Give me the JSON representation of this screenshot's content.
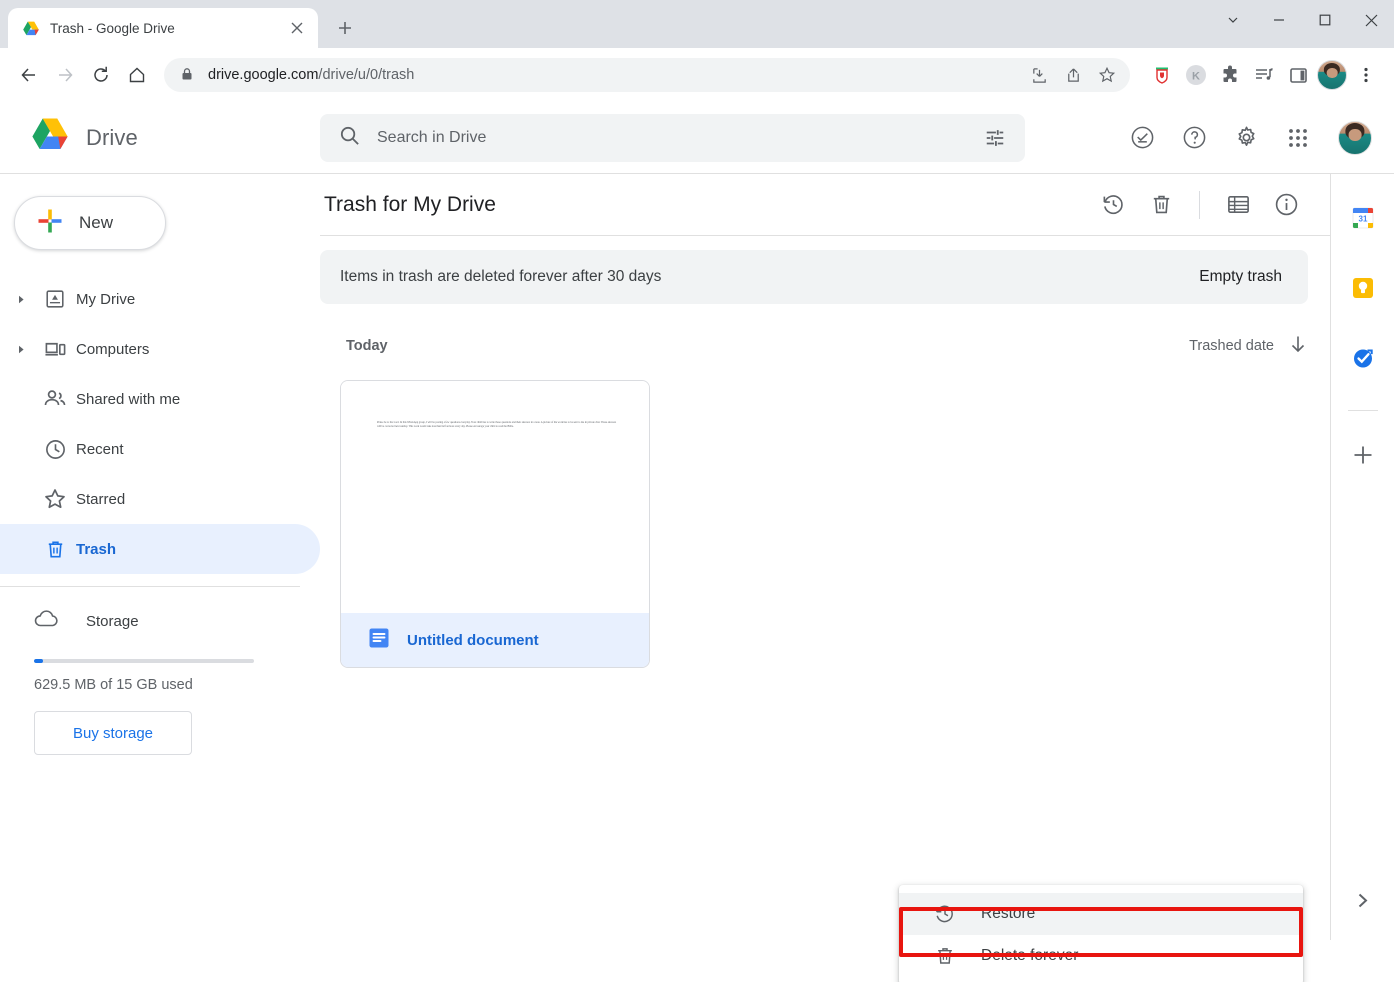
{
  "browser": {
    "tab": {
      "title": "Trash - Google Drive",
      "favicon": "google-drive-icon",
      "close": "×"
    },
    "new_tab_label": "+",
    "window_controls": {
      "tab_search": "⌄",
      "minimize": "–",
      "maximize": "□",
      "close": "×"
    },
    "nav": {
      "back": "←",
      "forward": "→",
      "reload": "⟳",
      "home": "⌂"
    },
    "omnibox": {
      "url_domain": "drive.google.com",
      "url_path": "/drive/u/0/trash",
      "lock": "lock-icon",
      "install": "install-icon",
      "share": "share-icon",
      "bookmark": "star-icon"
    },
    "extensions": [
      {
        "name": "honey-extension-icon",
        "label": ""
      },
      {
        "name": "k-extension-icon",
        "label": "K"
      },
      {
        "name": "puzzle-extensions-icon",
        "label": ""
      },
      {
        "name": "media-playlist-icon",
        "label": ""
      },
      {
        "name": "side-panel-icon",
        "label": ""
      }
    ],
    "profile": "profile-avatar",
    "menu": "three-dot-menu-icon"
  },
  "drive": {
    "brand": "Drive",
    "search": {
      "placeholder": "Search in Drive",
      "value": "",
      "tune": "tune-icon"
    },
    "header_actions": [
      {
        "name": "support-icon"
      },
      {
        "name": "help-icon"
      },
      {
        "name": "settings-gear-icon"
      },
      {
        "name": "apps-grid-icon"
      }
    ],
    "new_button": "New",
    "nav_items": [
      {
        "label": "My Drive",
        "icon": "my-drive-icon",
        "expandable": true,
        "active": false
      },
      {
        "label": "Computers",
        "icon": "computers-icon",
        "expandable": true,
        "active": false
      },
      {
        "label": "Shared with me",
        "icon": "shared-with-me-icon",
        "expandable": false,
        "active": false
      },
      {
        "label": "Recent",
        "icon": "recent-clock-icon",
        "expandable": false,
        "active": false
      },
      {
        "label": "Starred",
        "icon": "starred-star-icon",
        "expandable": false,
        "active": false
      },
      {
        "label": "Trash",
        "icon": "trash-icon",
        "expandable": false,
        "active": true
      }
    ],
    "storage": {
      "label": "Storage",
      "icon": "cloud-icon",
      "used_text": "629.5 MB of 15 GB used",
      "percent": 4,
      "buy_button": "Buy storage"
    },
    "main": {
      "title": "Trash for My Drive",
      "toolbar": [
        {
          "name": "restore-icon"
        },
        {
          "name": "delete-forever-icon"
        },
        {
          "name": "list-view-icon"
        },
        {
          "name": "details-info-icon"
        }
      ],
      "banner": {
        "text": "Items in trash are deleted forever after 30 days",
        "action": "Empty trash"
      },
      "group_label": "Today",
      "sort": {
        "label": "Trashed date",
        "direction": "down-arrow-icon"
      },
      "files": [
        {
          "name": "Untitled document",
          "icon": "google-docs-icon",
          "selected": true,
          "thumbnail_text": "Praise be to the Lord. In this WhatsApp group, I will be posting a few questions everyday. Your child has to write those questions and their answers in a note. A picture of the work has to be sent to me in private chat. These answers will be corrected next sunday.\nThis work would take less than half an hour every day. Please encourage your child to read the Bible."
        }
      ]
    },
    "context_menu": {
      "items": [
        {
          "label": "Restore",
          "icon": "restore-icon",
          "highlighted": true
        },
        {
          "label": "Delete forever",
          "icon": "trash-icon",
          "highlighted": false
        }
      ],
      "highlight_color": "#e8150f"
    },
    "rail": {
      "apps": [
        {
          "name": "google-calendar-icon"
        },
        {
          "name": "google-keep-icon"
        },
        {
          "name": "google-tasks-icon"
        }
      ],
      "add": "add-plus-icon",
      "expand": "chevron-right-icon"
    }
  }
}
